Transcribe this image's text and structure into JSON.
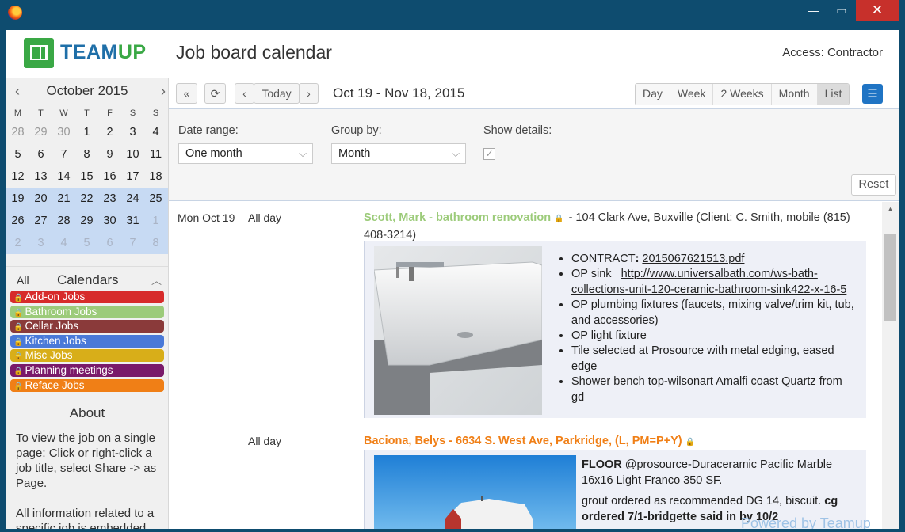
{
  "window": {
    "minimize_glyph": "—",
    "maximize_glyph": "▭",
    "close_glyph": "✕"
  },
  "header": {
    "brand_part1": "TEAM",
    "brand_part2": "UP",
    "title": "Job board calendar",
    "access": "Access: Contractor"
  },
  "mini_calendar": {
    "prev": "‹",
    "next": "›",
    "title": "October 2015",
    "dows": [
      "M",
      "T",
      "W",
      "T",
      "F",
      "S",
      "S"
    ],
    "weeks": [
      [
        "28",
        "29",
        "30",
        "1",
        "2",
        "3",
        "4"
      ],
      [
        "5",
        "6",
        "7",
        "8",
        "9",
        "10",
        "11"
      ],
      [
        "12",
        "13",
        "14",
        "15",
        "16",
        "17",
        "18"
      ],
      [
        "19",
        "20",
        "21",
        "22",
        "23",
        "24",
        "25"
      ],
      [
        "26",
        "27",
        "28",
        "29",
        "30",
        "31",
        "1"
      ],
      [
        "2",
        "3",
        "4",
        "5",
        "6",
        "7",
        "8"
      ]
    ]
  },
  "calendars": {
    "all": "All",
    "title": "Calendars",
    "collapse_glyph": "︿",
    "items": [
      {
        "label": "Add-on Jobs",
        "color": "#d72b2b"
      },
      {
        "label": "Bathroom Jobs",
        "color": "#9ccb7a"
      },
      {
        "label": "Cellar Jobs",
        "color": "#8a3a3a"
      },
      {
        "label": "Kitchen Jobs",
        "color": "#4a79d8"
      },
      {
        "label": "Misc Jobs",
        "color": "#d8ae19"
      },
      {
        "label": "Planning meetings",
        "color": "#7a1a6a"
      },
      {
        "label": "Reface Jobs",
        "color": "#f07f16"
      }
    ]
  },
  "about": {
    "title": "About",
    "p1": "To view the job on a single page: Click or right-click a job title, select Share -> as Page.",
    "p2": "All information related to a specific job is embedded..."
  },
  "toolbar": {
    "first": "«",
    "refresh": "⟳",
    "prev": "‹",
    "today": "Today",
    "next": "›",
    "range": "Oct 19 - Nov 18, 2015",
    "views": [
      "Day",
      "Week",
      "2 Weeks",
      "Month",
      "List"
    ],
    "menu": "☰"
  },
  "filters": {
    "date_range_label": "Date range:",
    "date_range_value": "One month",
    "group_by_label": "Group by:",
    "group_by_value": "Month",
    "show_details_label": "Show details:",
    "show_details_checked": true,
    "check_glyph": "✓",
    "reset": "Reset"
  },
  "events": [
    {
      "date": "Mon Oct 19",
      "time": "All day",
      "title": "Scott, Mark - bathroom renovation",
      "title_color": "#9ccb7a",
      "rest": " - 104 Clark Ave, Buxville (Client: C. Smith, mobile (815) 408-3214)",
      "contract_label": "CONTRACT",
      "contract_link": "2015067621513.pdf",
      "op_sink_label": "OP sink",
      "op_sink_link": "http://www.universalbath.com/ws-bath-collections-unit-120-ceramic-bathroom-sink422-x-16-5",
      "bullets": [
        "OP plumbing fixtures (faucets, mixing valve/trim kit, tub, and accessories)",
        "OP light fixture",
        "Tile selected at Prosource with metal edging, eased edge",
        "Shower bench top-wilsonart Amalfi coast Quartz from gd"
      ]
    },
    {
      "time": "All day",
      "title": "Baciona, Belys - 6634 S. West Ave, Parkridge, (L, PM=P+Y)",
      "title_color": "#f07f16",
      "floor_label": "FLOOR",
      "floor_text": " @prosource-Duraceramic Pacific Marble 16x16 Light Franco 350 SF.",
      "grout_text": "grout ordered as recommended DG 14, biscuit. ",
      "grout_bold": "cg ordered 7/1-bridgette said in by 10/2"
    }
  ],
  "watermark": "Powered by Teamup"
}
